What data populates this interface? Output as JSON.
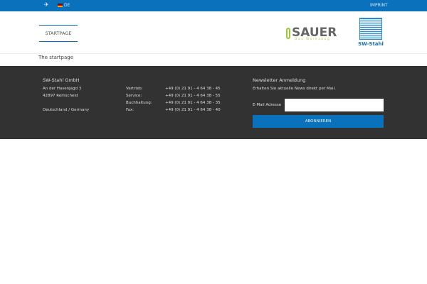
{
  "topbar": {
    "language": "DE",
    "imprint": "IMPRINT"
  },
  "nav": {
    "items": [
      {
        "label": "STARTPAGE"
      }
    ]
  },
  "logos": {
    "sauer": "SAUER",
    "sauer_sub": "Das Werkzeug",
    "swstahl": "SW-Stahl"
  },
  "breadcrumb": "The startpage",
  "footer": {
    "company": "SW-Stahl GmbH",
    "address": [
      "An der Hasenjagd 3",
      "42897 Remscheid",
      "Deutschland / Germany"
    ],
    "contacts": [
      {
        "label": "Vertrieb:",
        "value": "+49 (0) 21 91 - 4 64 38 - 45"
      },
      {
        "label": "Service:",
        "value": "+49 (0) 21 91 - 4 64 38 - 55"
      },
      {
        "label": "Buchhaltung:",
        "value": "+49 (0) 21 91 - 4 64 38 - 35"
      },
      {
        "label": "Fax:",
        "value": "+49 (0) 21 91 - 4 64 38 - 40"
      }
    ],
    "newsletter": {
      "title": "Newsletter Anmeldung",
      "text": "Erhalten Sie aktuelle News direkt per Mail.",
      "email_label": "E-Mail Adresse",
      "email_value": "",
      "button": "ABONNIEREN"
    }
  }
}
